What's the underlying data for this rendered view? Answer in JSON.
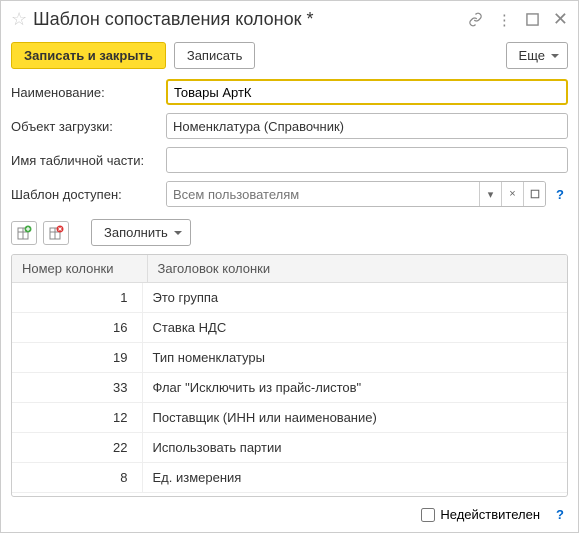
{
  "title": "Шаблон сопоставления колонок *",
  "toolbar": {
    "save_close": "Записать и закрыть",
    "save": "Записать",
    "more": "Еще"
  },
  "form": {
    "name_label": "Наименование:",
    "name_value": "Товары АртК",
    "object_label": "Объект загрузки:",
    "object_value": "Номенклатура (Справочник)",
    "tabname_label": "Имя табличной части:",
    "tabname_value": "",
    "access_label": "Шаблон доступен:",
    "access_placeholder": "Всем пользователям"
  },
  "subtoolbar": {
    "fill": "Заполнить"
  },
  "table": {
    "headers": {
      "num": "Номер колонки",
      "title": "Заголовок колонки"
    },
    "rows": [
      {
        "num": "1",
        "title": "Это группа"
      },
      {
        "num": "16",
        "title": "Ставка НДС"
      },
      {
        "num": "19",
        "title": "Тип номенклатуры"
      },
      {
        "num": "33",
        "title": "Флаг \"Исключить из прайс-листов\""
      },
      {
        "num": "12",
        "title": "Поставщик (ИНН или наименование)"
      },
      {
        "num": "22",
        "title": "Использовать партии"
      },
      {
        "num": "8",
        "title": "Ед. измерения"
      }
    ]
  },
  "footer": {
    "invalid_label": "Недействителен"
  },
  "help": "?"
}
